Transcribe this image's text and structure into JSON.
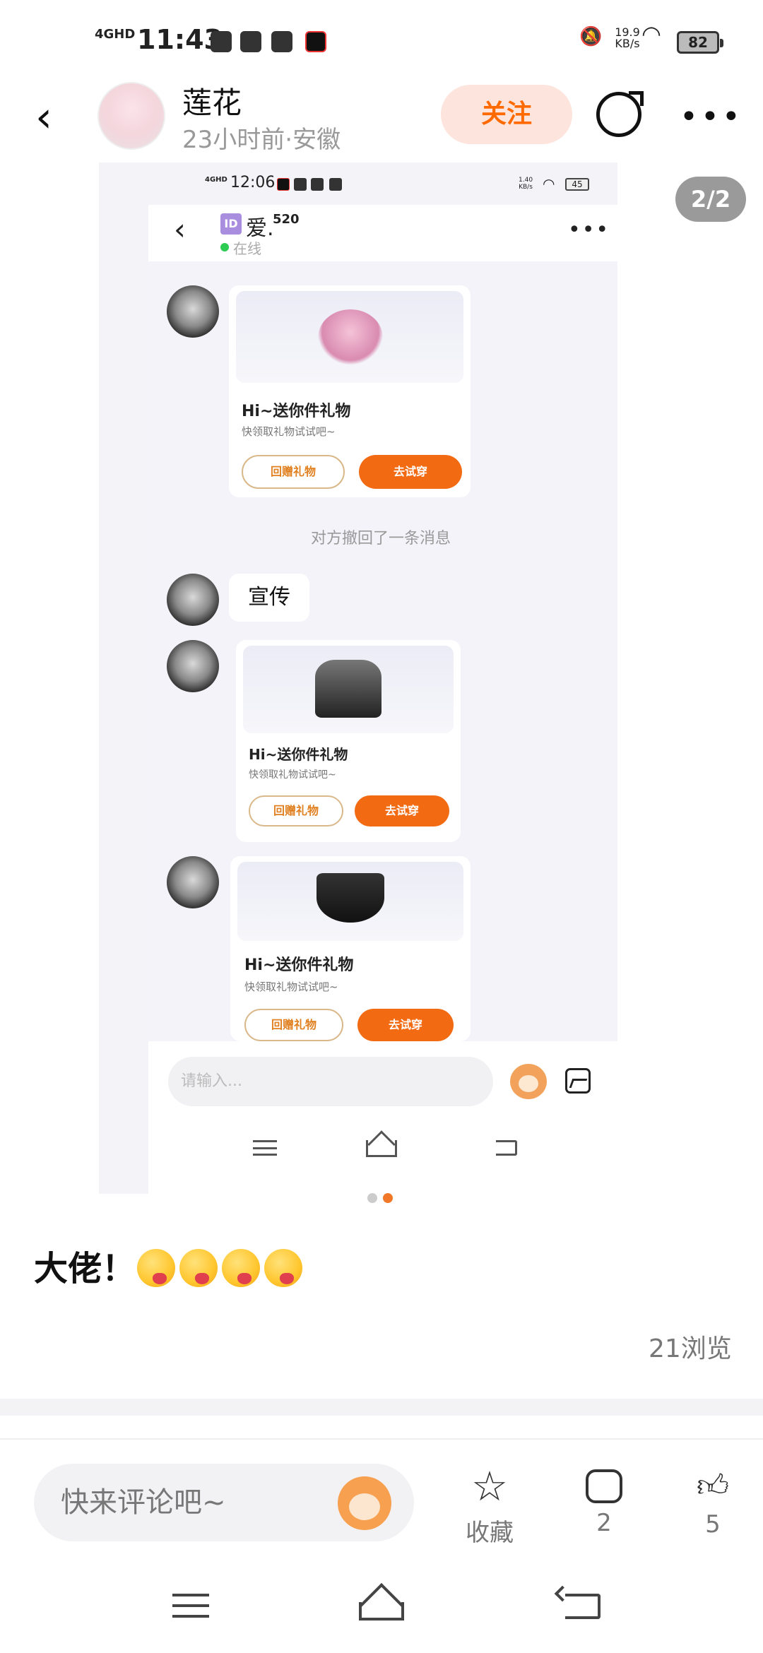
{
  "status_bar": {
    "network": "4GHD",
    "time": "11:43",
    "speed_value": "19.9",
    "speed_unit": "KB/s",
    "battery": "82"
  },
  "header": {
    "user_name": "莲花",
    "meta": "23小时前·安徽",
    "follow_label": "关注",
    "more": "•••",
    "back": "‹"
  },
  "gallery": {
    "page_indicator": "2/2"
  },
  "inner_screenshot": {
    "status": {
      "network": "4GHD",
      "time": "12:06",
      "speed_value": "1.40",
      "speed_unit": "KB/s",
      "battery": "45"
    },
    "chat_header": {
      "back": "‹",
      "id_badge": "ID",
      "name": "爱.",
      "name_sup": "520",
      "status": "在线",
      "more": "•••"
    },
    "messages": {
      "gift_1": {
        "title": "Hi~送你件礼物",
        "subtitle": "快领取礼物试试吧~",
        "return_label": "回赠礼物",
        "try_label": "去试穿"
      },
      "recalled": "对方撤回了一条消息",
      "text_bubble": "宣传",
      "gift_2": {
        "title": "Hi~送你件礼物",
        "subtitle": "快领取礼物试试吧~",
        "return_label": "回赠礼物",
        "try_label": "去试穿"
      },
      "gift_3": {
        "title": "Hi~送你件礼物",
        "subtitle": "快领取礼物试试吧~",
        "return_label": "回赠礼物",
        "try_label": "去试穿"
      }
    },
    "input_placeholder": "请输入..."
  },
  "dots": {
    "count": 2,
    "active_index": 1,
    "active_color": "#f07828",
    "inactive_color": "#cccccc"
  },
  "post": {
    "text": "大佬！",
    "emoji_count": 4,
    "views": "21浏览"
  },
  "bottom_bar": {
    "comment_placeholder": "快来评论吧~",
    "favorite_label": "收藏",
    "comment_count": "2",
    "like_count": "5"
  },
  "colors": {
    "accent": "#ff6a00",
    "follow_bg": "#fde4dc",
    "try_button": "#f26a12"
  }
}
